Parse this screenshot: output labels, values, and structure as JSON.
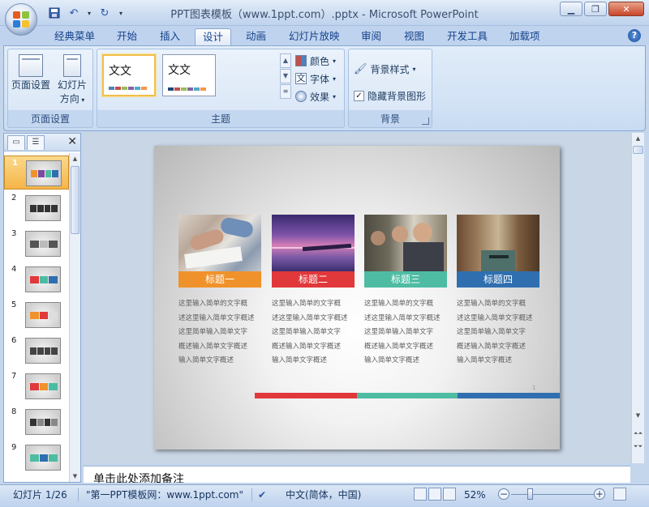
{
  "window": {
    "title": "PPT图表模板（www.1ppt.com）.pptx - Microsoft PowerPoint"
  },
  "tabs": [
    "经典菜单",
    "开始",
    "插入",
    "设计",
    "动画",
    "幻灯片放映",
    "审阅",
    "视图",
    "开发工具",
    "加载项"
  ],
  "active_tab": "设计",
  "ribbon": {
    "page_setup": {
      "page_setup_label": "页面设置",
      "orientation_label_1": "幻灯片",
      "orientation_label_2": "方向",
      "group_label": "页面设置"
    },
    "themes": {
      "theme_thumb_1": "文文",
      "theme_thumb_2": "文文",
      "colors_label": "颜色",
      "fonts_label": "字体",
      "effects_label": "效果",
      "group_label": "主题"
    },
    "background": {
      "styles_label": "背景样式",
      "hide_graphics_label": "隐藏背景图形",
      "hide_graphics_checked": true,
      "group_label": "背景"
    }
  },
  "thumbnails": [
    "1",
    "2",
    "3",
    "4",
    "5",
    "6",
    "7",
    "8",
    "9"
  ],
  "selected_thumbnail": "1",
  "slide": {
    "cards": [
      {
        "title": "标题一",
        "color": "#f0922b",
        "desc": [
          "这里输入简单的文字概",
          "述这里输入简单文字概述",
          "这里简单输入简单文字",
          "概述输入简单文字概述",
          "输入简单文字概述"
        ]
      },
      {
        "title": "标题二",
        "color": "#e0383b",
        "desc": [
          "这里输入简单的文字概",
          "述这里输入简单文字概述",
          "这里简单输入简单文字",
          "概述输入简单文字概述",
          "输入简单文字概述"
        ]
      },
      {
        "title": "标题三",
        "color": "#4ebca3",
        "desc": [
          "这里输入简单的文字概",
          "述这里输入简单文字概述",
          "这里简单输入简单文字",
          "概述输入简单文字概述",
          "输入简单文字概述"
        ]
      },
      {
        "title": "标题四",
        "color": "#2f6fb0",
        "desc": [
          "这里输入简单的文字概",
          "述这里输入简单文字概述",
          "这里简单输入简单文字",
          "概述输入简单文字概述",
          "输入简单文字概述"
        ]
      }
    ],
    "page_number": "1"
  },
  "notes_placeholder": "单击此处添加备注",
  "status": {
    "slide_counter": "幻灯片 1/26",
    "theme_name": "\"第一PPT模板网：www.1ppt.com\"",
    "language": "中文(简体，中国)",
    "zoom": "52%"
  },
  "colors": {
    "accent_orange": "#f0922b",
    "accent_red": "#e0383b",
    "accent_teal": "#4ebca3",
    "accent_blue": "#2f6fb0"
  }
}
